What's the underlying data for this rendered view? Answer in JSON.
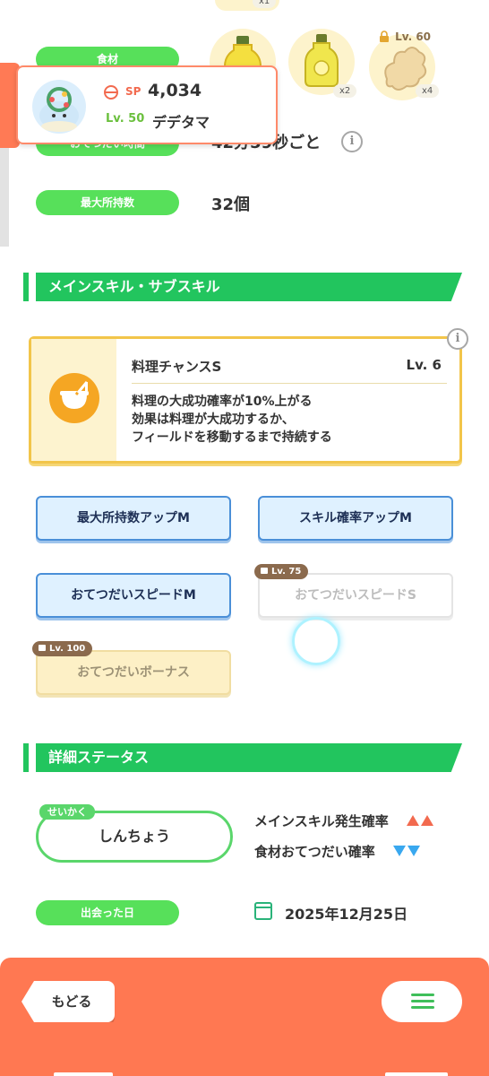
{
  "ingredients": {
    "label": "食材",
    "top_peek_count": "x1",
    "items": [
      {
        "name": "honey",
        "count": ""
      },
      {
        "name": "oil",
        "count": "x2"
      },
      {
        "name": "ginger",
        "count": "x4",
        "lock_level": "Lv. 60"
      }
    ]
  },
  "popup": {
    "sp_label": "SP",
    "sp_value": "4,034",
    "level": "Lv. 50",
    "pokemon_name": "デデタマ"
  },
  "help_interval": {
    "label": "おてつだい時間",
    "value": "42分59秒ごと"
  },
  "max_carry": {
    "label": "最大所持数",
    "value": "32個"
  },
  "skills_section": {
    "title": "メインスキル・サブスキル",
    "main_skill": {
      "name": "料理チャンスS",
      "level": "Lv. 6",
      "desc_line1": "料理の大成功確率が10%上がる",
      "desc_line2": "効果は料理が大成功するか、",
      "desc_line3": "フィールドを移動するまで持続する"
    },
    "sub_skills": [
      {
        "label": "最大所持数アップM",
        "state": "unlocked"
      },
      {
        "label": "スキル確率アップM",
        "state": "unlocked"
      },
      {
        "label": "おてつだいスピードM",
        "state": "unlocked"
      },
      {
        "label": "おてつだいスピードS",
        "state": "locked",
        "lock_level": "Lv. 75"
      },
      {
        "label": "おてつだいボーナス",
        "state": "locked-gold",
        "lock_level": "Lv. 100"
      }
    ]
  },
  "details_section": {
    "title": "詳細ステータス",
    "nature_tag": "せいかく",
    "nature": "しんちょう",
    "up_effect": "メインスキル発生確率",
    "down_effect": "食材おてつだい確率",
    "met_label": "出会った日",
    "met_date": "2025年12月25日"
  },
  "footer": {
    "back_label": "もどる"
  },
  "colors": {
    "green_pill": "#57e05a",
    "section_green": "#22c55e",
    "orange": "#ff7852",
    "skill_gold": "#f2c54a",
    "sub_blue": "#4a8fd8"
  }
}
